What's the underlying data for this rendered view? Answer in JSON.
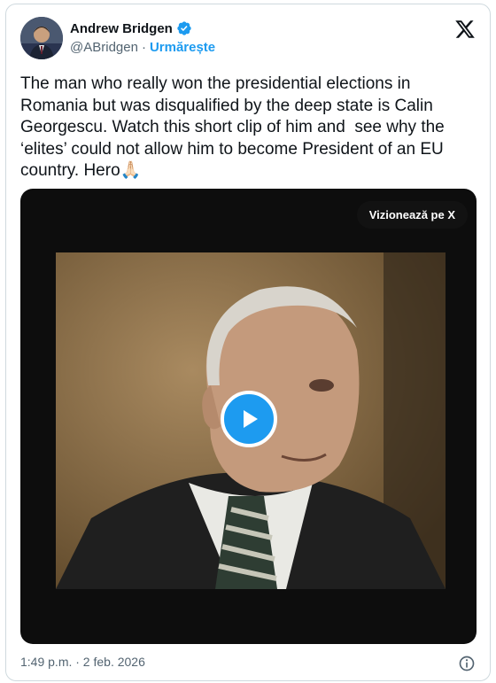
{
  "author": {
    "display_name": "Andrew Bridgen",
    "handle": "@ABridgen",
    "separator": "·",
    "follow_label": "Urmărește"
  },
  "tweet": {
    "text": "The man who really won the presidential elections in Romania but was disqualified by the deep state is Calin Georgescu. Watch this short clip of him and  see why the ‘elites’ could not allow him to become President of an EU country. Hero🙏🏻"
  },
  "media": {
    "watch_label": "Vizionează pe X"
  },
  "footer": {
    "timestamp": "1:49 p.m. · 2 feb. 2026"
  },
  "colors": {
    "accent": "#1d9bf0",
    "text": "#0f1419",
    "muted": "#536471"
  },
  "icons": {
    "verified": "verified-badge-icon",
    "logo": "x-logo-icon",
    "play": "play-icon",
    "info": "info-icon"
  }
}
